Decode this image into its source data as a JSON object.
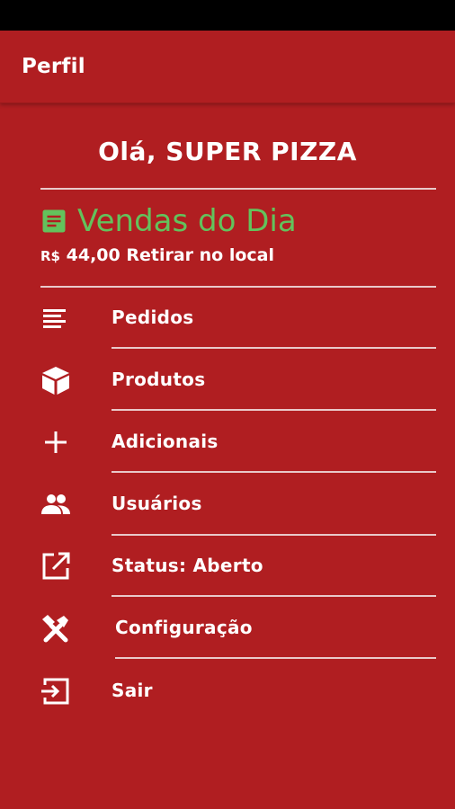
{
  "app_bar": {
    "title": "Perfil"
  },
  "greeting": "Olá, SUPER PIZZA",
  "sales": {
    "title": "Vendas do Dia",
    "currency": "R$",
    "amount": "44,00 Retirar no local",
    "title_color": "#63c25c",
    "icon": "document-icon"
  },
  "menu": {
    "items": [
      {
        "label": "Pedidos",
        "icon": "list-icon"
      },
      {
        "label": "Produtos",
        "icon": "box-icon"
      },
      {
        "label": "Adicionais",
        "icon": "plus-icon"
      },
      {
        "label": "Usuários",
        "icon": "users-icon"
      },
      {
        "label": "Status: Aberto",
        "icon": "open-external-icon"
      },
      {
        "label": "Configuração",
        "icon": "tools-icon"
      },
      {
        "label": "Sair",
        "icon": "exit-icon"
      }
    ]
  },
  "colors": {
    "background": "#b01e21",
    "status_bar": "#000000",
    "text": "#ffffff",
    "divider": "#e9c9ca"
  }
}
